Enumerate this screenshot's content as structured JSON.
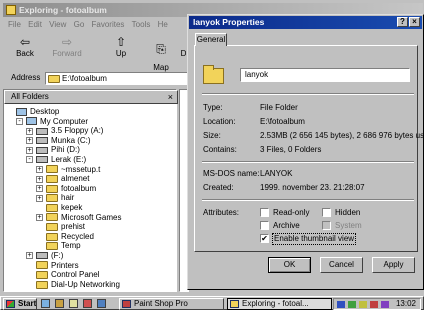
{
  "explorer": {
    "title": "Exploring - fotoalbum",
    "menu": [
      "File",
      "Edit",
      "View",
      "Go",
      "Favorites",
      "Tools",
      "He"
    ],
    "toolbar": {
      "back": "Back",
      "forward": "Forward",
      "up": "Up",
      "map_drive": "Map\nDrive",
      "d": "D"
    },
    "address_label": "Address",
    "address_value": "E:\\fotoalbum",
    "tree_header": "All Folders",
    "tree_close": "×",
    "tree": [
      {
        "label": "Desktop",
        "icon": "desktop-icon",
        "level": 0,
        "pm": ""
      },
      {
        "label": "My Computer",
        "icon": "computer-icon",
        "level": 1,
        "pm": "-"
      },
      {
        "label": "3.5 Floppy (A:)",
        "icon": "floppy-icon",
        "level": 2,
        "pm": "+"
      },
      {
        "label": "Munka (C:)",
        "icon": "drive-icon",
        "level": 2,
        "pm": "+"
      },
      {
        "label": "Pihi (D:)",
        "icon": "drive-icon",
        "level": 2,
        "pm": "+"
      },
      {
        "label": "Lerak (E:)",
        "icon": "drive-icon",
        "level": 2,
        "pm": "-"
      },
      {
        "label": "~mssetup.t",
        "icon": "folder-icon",
        "level": 3,
        "pm": "+"
      },
      {
        "label": "almenet",
        "icon": "folder-icon",
        "level": 3,
        "pm": "+"
      },
      {
        "label": "fotoalbum",
        "icon": "folder-icon",
        "level": 3,
        "pm": "+"
      },
      {
        "label": "hair",
        "icon": "folder-icon",
        "level": 3,
        "pm": "+"
      },
      {
        "label": "kepek",
        "icon": "folder-icon",
        "level": 3,
        "pm": ""
      },
      {
        "label": "Microsoft Games",
        "icon": "folder-icon",
        "level": 3,
        "pm": "+"
      },
      {
        "label": "prehist",
        "icon": "folder-icon",
        "level": 3,
        "pm": ""
      },
      {
        "label": "Recycled",
        "icon": "recycle-icon",
        "level": 3,
        "pm": ""
      },
      {
        "label": "Temp",
        "icon": "folder-icon",
        "level": 3,
        "pm": ""
      },
      {
        "label": "(F:)",
        "icon": "cdrom-icon",
        "level": 2,
        "pm": "+"
      },
      {
        "label": "Printers",
        "icon": "printer-folder-icon",
        "level": 2,
        "pm": ""
      },
      {
        "label": "Control Panel",
        "icon": "control-panel-icon",
        "level": 2,
        "pm": ""
      },
      {
        "label": "Dial-Up Networking",
        "icon": "network-icon",
        "level": 2,
        "pm": ""
      }
    ]
  },
  "dialog": {
    "title": "lanyok Properties",
    "help_btn": "?",
    "close_btn": "×",
    "tab": "General",
    "folder_name": "lanyok",
    "rows": {
      "type_label": "Type:",
      "type_value": "File Folder",
      "location_label": "Location:",
      "location_value": "E:\\fotoalbum",
      "size_label": "Size:",
      "size_value": "2.53MB (2 656 145 bytes), 2 686 976 bytes used",
      "contains_label": "Contains:",
      "contains_value": "3 Files, 0 Folders",
      "msdos_label": "MS-DOS name:",
      "msdos_value": "LANYOK",
      "created_label": "Created:",
      "created_value": "1999. november 23. 21:28:07",
      "attributes_label": "Attributes:"
    },
    "attributes": {
      "readonly": "Read-only",
      "hidden": "Hidden",
      "archive": "Archive",
      "system": "System",
      "thumbnail": "Enable thumbnail view",
      "thumbnail_checked": "✔"
    },
    "buttons": {
      "ok": "OK",
      "cancel": "Cancel",
      "apply": "Apply"
    }
  },
  "taskbar": {
    "start": "Start",
    "tasks": [
      "Paint Shop Pro",
      "Exploring - fotoal..."
    ],
    "clock": "13:02"
  },
  "right_window_controls": {
    "max": "▭",
    "close": "×"
  }
}
